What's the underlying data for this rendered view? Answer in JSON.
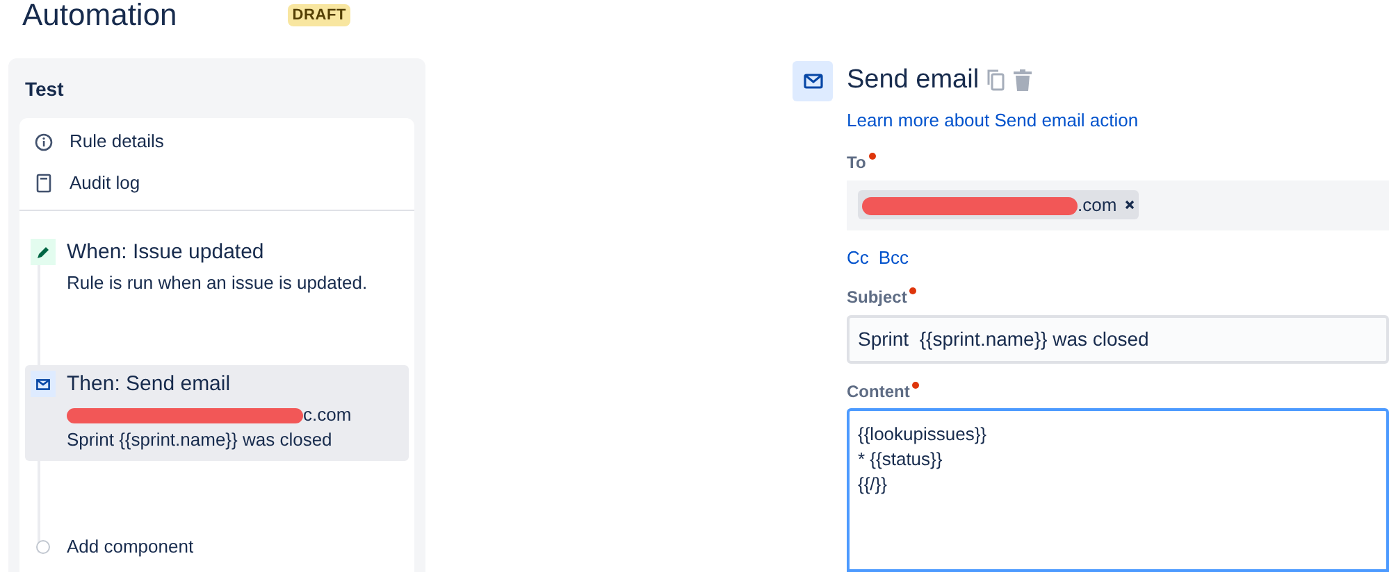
{
  "header": {
    "title": "Automation",
    "badge": "DRAFT"
  },
  "sidebar": {
    "title": "Test",
    "menu": [
      {
        "label": "Rule details"
      },
      {
        "label": "Audit log"
      }
    ],
    "steps": [
      {
        "kind": "trigger",
        "title": "When: Issue updated",
        "lines": [
          {
            "text": "Rule is run when an issue is updated.",
            "redacted": false
          }
        ],
        "selected": false
      },
      {
        "kind": "action",
        "title": "Then: Send email",
        "lines": [
          {
            "text": "c.com",
            "redacted": true
          },
          {
            "text": "Sprint {{sprint.name}} was closed",
            "redacted": false
          }
        ],
        "selected": true
      },
      {
        "kind": "add",
        "title": "Add component",
        "selected": false
      }
    ]
  },
  "editor": {
    "title": "Send email",
    "link": "Learn more about Send email action",
    "to": {
      "label": "To",
      "required": true,
      "recipients": [
        {
          "text": ".com",
          "redacted": true
        }
      ]
    },
    "cc_links": [
      "Cc",
      "Bcc"
    ],
    "subject": {
      "label": "Subject",
      "required": true,
      "value": "Sprint  {{sprint.name}} was closed"
    },
    "content": {
      "label": "Content",
      "required": true,
      "focused": true,
      "lines": [
        "{{lookupissues}}",
        "* {{status}}",
        "{{/}}"
      ]
    }
  }
}
